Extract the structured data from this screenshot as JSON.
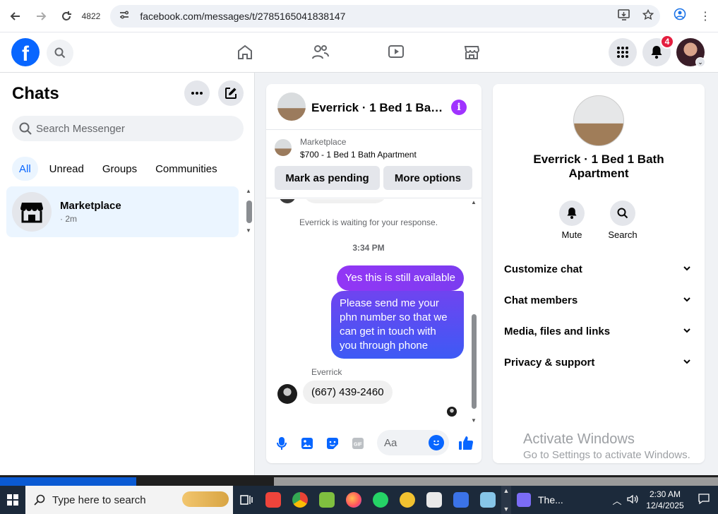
{
  "browser": {
    "tab_count": "4822",
    "url": "facebook.com/messages/t/2785165041838147"
  },
  "fb": {
    "logo_letter": "f",
    "notifications_count": "4"
  },
  "left": {
    "title": "Chats",
    "search_placeholder": "Search Messenger",
    "filters": [
      "All",
      "Unread",
      "Groups",
      "Communities"
    ],
    "chat": {
      "name": "Marketplace",
      "time": "· 2m"
    }
  },
  "conversation": {
    "title": "Everrick · 1 Bed 1 Bath Apartment",
    "marketplace_label": "Marketplace",
    "listing": "$700 - 1 Bed 1 Bath Apartment",
    "mark_pending": "Mark as pending",
    "more_options": "More options",
    "waiting_text": "Everrick is waiting for your response.",
    "timestamp": "3:34 PM",
    "messages": {
      "out1": "Yes this is still available",
      "out2": "Please send me your phn number so that we can get in touch with you through phone",
      "sender": "Everrick",
      "in1": "(667) 439-2460"
    },
    "composer_placeholder": "Aa"
  },
  "right": {
    "title": "Everrick · 1 Bed 1 Bath Apartment",
    "mute": "Mute",
    "search": "Search",
    "sections": [
      "Customize chat",
      "Chat members",
      "Media, files and links",
      "Privacy & support"
    ],
    "watermark_title": "Activate Windows",
    "watermark_sub": "Go to Settings to activate Windows."
  },
  "taskbar": {
    "search_placeholder": "Type here to search",
    "task_label": "The...",
    "time": "2:30 AM",
    "date": "12/4/2025"
  },
  "colors": {
    "fb_blue": "#0866ff",
    "out_bubble_start": "#9336f5",
    "out_bubble_end": "#3d5af5",
    "info_purple": "#a033ff",
    "badge_red": "#e41e3f"
  }
}
